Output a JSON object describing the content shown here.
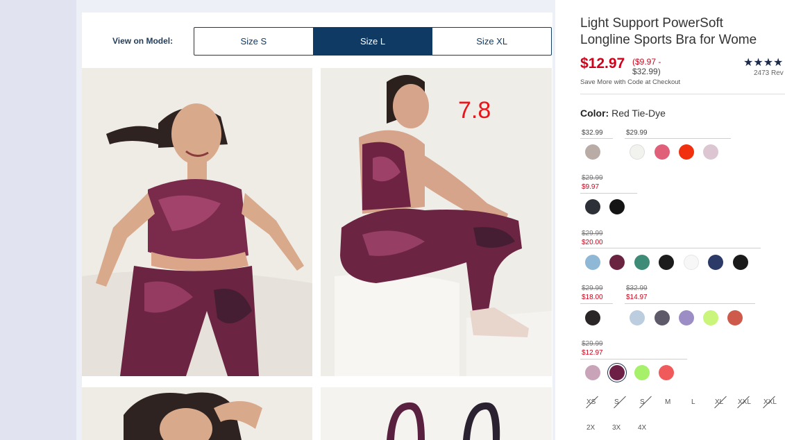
{
  "viewer": {
    "label": "View on Model:",
    "sizes": [
      {
        "label": "Size S",
        "active": false
      },
      {
        "label": "Size L",
        "active": true
      },
      {
        "label": "Size XL",
        "active": false
      }
    ],
    "overlay_score": "7.8"
  },
  "product": {
    "title_line1": "Light Support PowerSoft",
    "title_line2": "Longline Sports Bra for Wome",
    "price": "$12.97",
    "range_line1": "($9.97 -",
    "range_line2": "$32.99)",
    "stars": "★★★★",
    "reviews": "2473 Rev",
    "promo": "Save More with Code at Checkout",
    "color_label": "Color:",
    "color_value": "Red Tie-Dye"
  },
  "price_groups": [
    {
      "plain": "$32.99"
    },
    {
      "plain": "$29.99"
    },
    {
      "strike": "$29.99",
      "sale": "$9.97"
    },
    {
      "strike": "$29.99",
      "sale": "$20.00"
    },
    {
      "strike": "$29.99",
      "sale": "$18.00"
    },
    {
      "strike": "$32.99",
      "sale": "$14.97"
    },
    {
      "strike": "$29.99",
      "sale": "$12.97"
    }
  ],
  "swatch_colors": {
    "row1": [
      "#b9aba6",
      "#f2f2ef",
      "#e0607a",
      "#f0300f",
      "#dcc6d2"
    ],
    "row2": [
      "#2d3036",
      "#141414"
    ],
    "row3": [
      "#8fb7d6",
      "#6b2440",
      "#3e8c77",
      "#1c1c1c",
      "#f7f7f7",
      "#2b3a66",
      "#1a1a1a"
    ],
    "row4": [
      "#2a2627",
      "#bccde0",
      "#5e5a6a",
      "#9c8ec4",
      "#c8f57a",
      "#cd5a4a"
    ],
    "row5": [
      "#c9a4b8",
      "#6e1f46",
      "#a6f06a",
      "#f05a5a"
    ]
  },
  "sizes": {
    "row1": [
      "XS",
      "S",
      "S",
      "M",
      "L",
      "XL",
      "XXL",
      "XXL"
    ],
    "row2": [
      "2X",
      "3X",
      "4X"
    ]
  }
}
